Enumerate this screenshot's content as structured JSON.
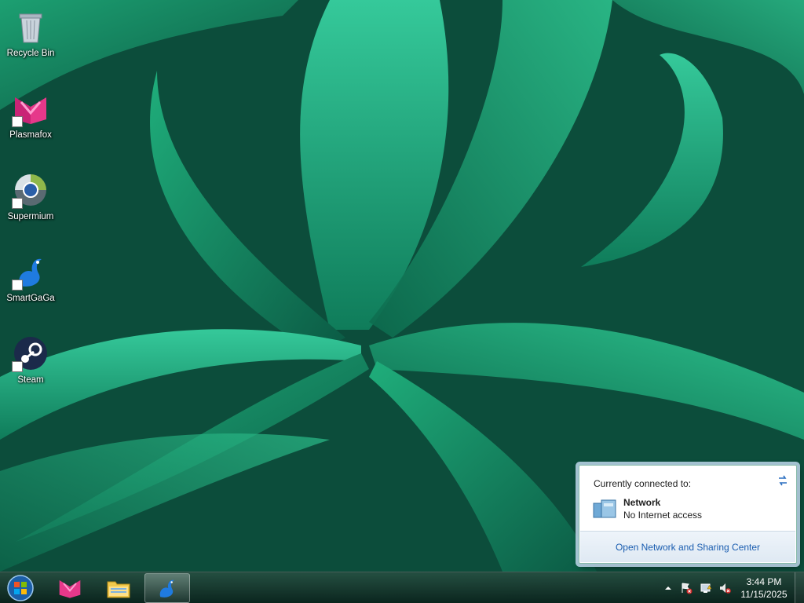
{
  "desktop": {
    "icons": [
      {
        "label": "Recycle Bin",
        "icon": "recycle-bin-icon"
      },
      {
        "label": "Plasmafox",
        "icon": "plasmafox-icon"
      },
      {
        "label": "Supermium",
        "icon": "supermium-icon"
      },
      {
        "label": "SmartGaGa",
        "icon": "smartgaga-icon"
      },
      {
        "label": "Steam",
        "icon": "steam-icon"
      }
    ]
  },
  "taskbar": {
    "pinned": [
      {
        "icon": "start-orb-icon"
      },
      {
        "icon": "plasmafox-icon"
      },
      {
        "icon": "file-explorer-icon"
      },
      {
        "icon": "smartgaga-icon",
        "active": true
      }
    ],
    "tray": {
      "show_hidden_icon": "chevron-up-icon",
      "icons": [
        "action-center-flag-icon",
        "network-icon",
        "volume-muted-icon"
      ]
    },
    "clock": {
      "time": "3:44 PM",
      "date": "11/15/2025"
    }
  },
  "network_popup": {
    "header": "Currently connected to:",
    "network_name": "Network",
    "network_status": "No Internet access",
    "footer_link": "Open Network and Sharing Center"
  },
  "colors": {
    "accent_link": "#1a5db0",
    "wallpaper_green": "#118a63"
  }
}
